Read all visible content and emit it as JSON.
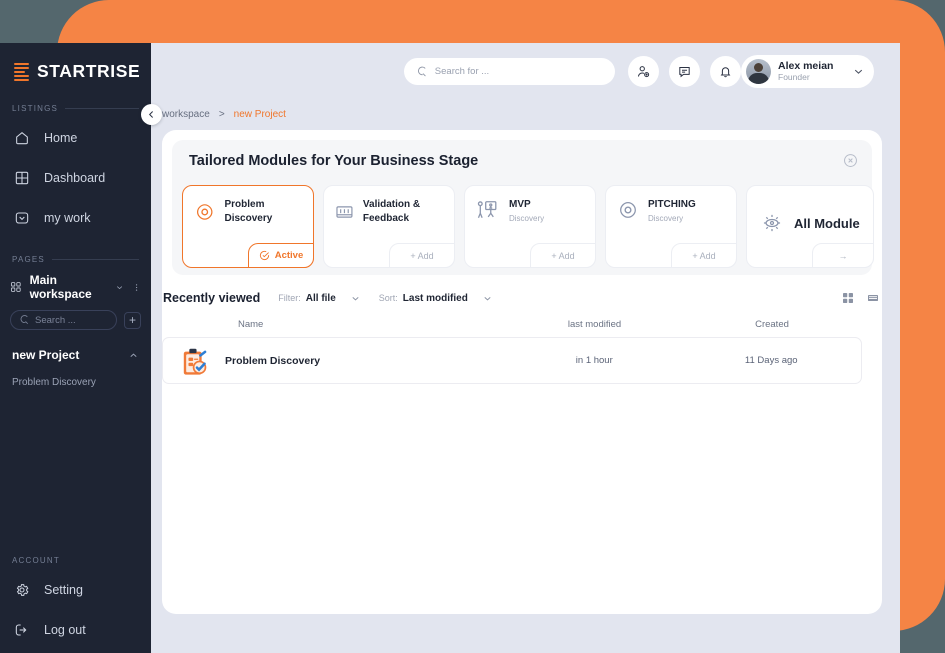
{
  "brand": {
    "name": "STARTRISE",
    "logo_icon": "startrise-bars-logo",
    "accent": "#f0762b"
  },
  "sidebar": {
    "listings_label": "LISTINGS",
    "listings": [
      {
        "label": "Home",
        "icon": "home-icon"
      },
      {
        "label": "Dashboard",
        "icon": "grid-icon"
      },
      {
        "label": "my work",
        "icon": "inbox-chevron-icon"
      }
    ],
    "pages_label": "PAGES",
    "workspace": {
      "label": "Main workspace",
      "icon": "squares-icon",
      "caret": "chevron-down-icon",
      "more": "kebab-menu-icon"
    },
    "search": {
      "placeholder": "Search ...",
      "icon": "search-icon"
    },
    "add_label": "+",
    "project": {
      "label": "new Project",
      "caret": "chevron-up-icon"
    },
    "project_child": "Problem Discovery",
    "account_label": "ACCOUNT",
    "account": [
      {
        "label": "Setting",
        "icon": "gear-icon"
      },
      {
        "label": "Log out",
        "icon": "logout-icon"
      }
    ],
    "collapse_icon": "chevron-left-icon"
  },
  "topbar": {
    "search": {
      "placeholder": "Search for ...",
      "value": "",
      "icon": "search-icon"
    },
    "actions": [
      {
        "name": "add-user-icon"
      },
      {
        "name": "message-icon"
      },
      {
        "name": "bell-icon"
      }
    ],
    "profile": {
      "name": "Alex meian",
      "role": "Founder",
      "caret": "chevron-down-icon",
      "avatar": "user-avatar"
    }
  },
  "breadcrumb": {
    "root": "workspace",
    "separator": ">",
    "current": "new Project"
  },
  "modules": {
    "title": "Tailored Modules for Your Business Stage",
    "close_icon": "close-circle-icon",
    "cards": [
      {
        "name": "Problem Discovery",
        "sub": "",
        "chip": "Active",
        "chip_icon": "check-circle-icon",
        "icon": "eye-leaf-icon",
        "active": true
      },
      {
        "name": "Validation & Feedback",
        "sub": "",
        "chip": "+ Add",
        "icon": "kanban-icon",
        "active": false
      },
      {
        "name": "MVP",
        "sub": "Discovery",
        "chip": "+ Add",
        "icon": "presentation-person-icon",
        "active": false
      },
      {
        "name": "PITCHING",
        "sub": "Discovery",
        "chip": "+ Add",
        "icon": "eye-leaf-icon",
        "active": false
      }
    ],
    "all_module": {
      "label": "All Module",
      "icon": "sun-eye-icon",
      "chip": "→"
    }
  },
  "recently_viewed": {
    "title": "Recently viewed",
    "filter_label": "Filter:",
    "filter_value": "All file",
    "sort_label": "Sort:",
    "sort_value": "Last modified",
    "views": [
      {
        "name": "grid-view-icon",
        "active": false
      },
      {
        "name": "list-view-icon",
        "active": true
      }
    ]
  },
  "table": {
    "columns": [
      "Name",
      "last modified",
      "Created"
    ],
    "rows": [
      {
        "name": "Problem Discovery",
        "icon": "clipboard-task-icon",
        "last_modified": "in 1 hour",
        "created": "11 Days ago"
      }
    ]
  }
}
